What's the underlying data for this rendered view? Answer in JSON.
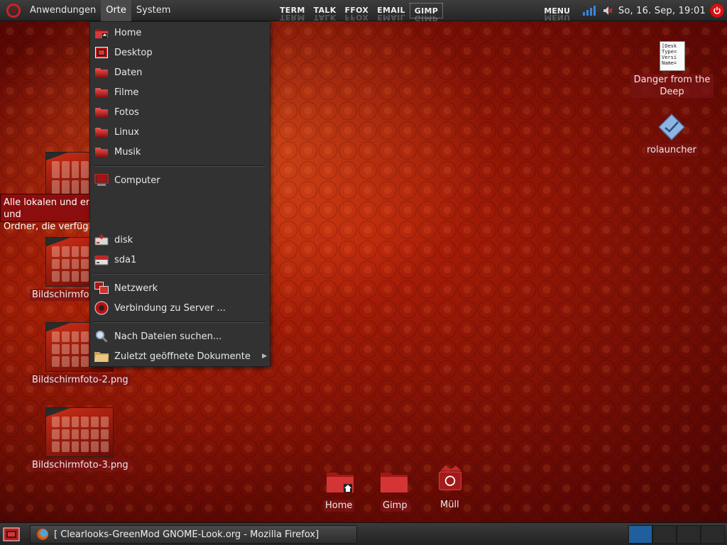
{
  "top_panel": {
    "menus": [
      "Anwendungen",
      "Orte",
      "System"
    ],
    "launchers": [
      "TERM",
      "TALK",
      "FFOX",
      "EMAIL",
      "GIMP"
    ],
    "menu_button": "MENU",
    "clock": "So, 16. Sep, 19:01"
  },
  "places_menu": {
    "items": [
      {
        "label": "Home",
        "icon": "home-folder-icon"
      },
      {
        "label": "Desktop",
        "icon": "desktop-icon"
      },
      {
        "label": "Daten",
        "icon": "folder-icon"
      },
      {
        "label": "Filme",
        "icon": "folder-icon"
      },
      {
        "label": "Fotos",
        "icon": "folder-icon"
      },
      {
        "label": "Linux",
        "icon": "folder-icon"
      },
      {
        "label": "Musik",
        "icon": "folder-icon"
      },
      {
        "label": "Computer",
        "icon": "computer-icon"
      },
      {
        "label": "disk",
        "icon": "drive-icon"
      },
      {
        "label": "sda1",
        "icon": "drive-icon"
      },
      {
        "label": "Netzwerk",
        "icon": "network-icon"
      },
      {
        "label": "Verbindung zu Server ...",
        "icon": "server-icon"
      },
      {
        "label": "Nach Dateien suchen...",
        "icon": "search-icon"
      },
      {
        "label": "Zuletzt geöffnete Dokumente",
        "icon": "recent-documents-icon"
      }
    ]
  },
  "tooltip": {
    "line1": "Alle lokalen und entfernten Datenträger und",
    "line2": "Ordner, die verfügbar sind, durchsuchen"
  },
  "desktop": {
    "screenshot_labels": [
      "Bildschirmfoto",
      "Bildschirmfoto-2.png",
      "Bildschirmfoto-3.png"
    ],
    "doc_icon_text": [
      "[Desk",
      "Type=",
      "Versi",
      "Name="
    ],
    "doc_label_line1": "Danger from the",
    "doc_label_line2": "Deep",
    "launcher_label": "rolauncher",
    "bottom_icons": [
      "Home",
      "Gimp",
      "Müll"
    ]
  },
  "bottom_panel": {
    "task_title": "[ Clearlooks-GreenMod  GNOME-Look.org  -  Mozilla  Firefox]",
    "workspaces": 4,
    "active_workspace": 1
  },
  "colors": {
    "panel": "#2e2e2e",
    "menu_bg": "#323232",
    "tooltip_bg": "#8b0d0d",
    "workspace_active": "#1f5f9e"
  }
}
